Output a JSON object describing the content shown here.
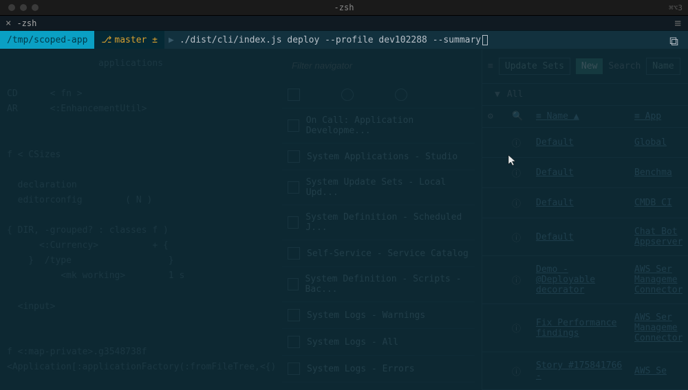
{
  "window": {
    "title": "-zsh",
    "right_indicator": "⌘⌥3"
  },
  "tab": {
    "title": "-zsh"
  },
  "prompt": {
    "path": "/tmp/scoped-app",
    "branch": "master ±",
    "command": "./dist/cli/index.js deploy --profile dev102288 --summary"
  },
  "dim_left": {
    "lines": [
      "                 applications",
      "",
      "CD      < fn >",
      "AR      <:EnhancementUtil>",
      "",
      "",
      "f < CSizes",
      "",
      "  declaration",
      "  editorconfig        ( N )",
      "",
      "{ DIR, -grouped? : classes f )",
      "      <:Currency>          + {",
      "    }  /type                  }",
      "          <mk working>        1 s",
      "",
      "  <input>",
      "",
      "",
      "f <:map-private>.g3548738f",
      "<Application[:applicationFactory(:fromFileTree,<{)"
    ]
  },
  "nav": {
    "search_placeholder": "Filter navigator",
    "items": [
      "On Call: Application Developme...",
      "System Applications - Studio",
      "System Update Sets - Local Upd...",
      "System Definition - Scheduled J...",
      "Self-Service - Service Catalog",
      "System Definition - Scripts - Bac...",
      "System Logs - Warnings",
      "System Logs - All",
      "System Logs - Errors"
    ]
  },
  "list": {
    "toolbar": {
      "update_sets": "Update Sets",
      "new": "New",
      "search": "Search",
      "name": "Name"
    },
    "filter_all": "All",
    "columns": {
      "name": "Name",
      "app": "App"
    },
    "rows": [
      {
        "name": "Default",
        "app": "Global"
      },
      {
        "name": "Default",
        "app": "Benchma"
      },
      {
        "name": "Default",
        "app": "CMDB CI"
      },
      {
        "name": "Default",
        "app": "Chat Bot Appserver"
      },
      {
        "name": "Demo - @Deployable decorator",
        "app": "AWS Ser Manageme Connector"
      },
      {
        "name": "Fix Performance findings",
        "app": "AWS Ser Manageme Connector"
      },
      {
        "name": "Story #175841766 -",
        "app": "AWS Se"
      }
    ]
  }
}
